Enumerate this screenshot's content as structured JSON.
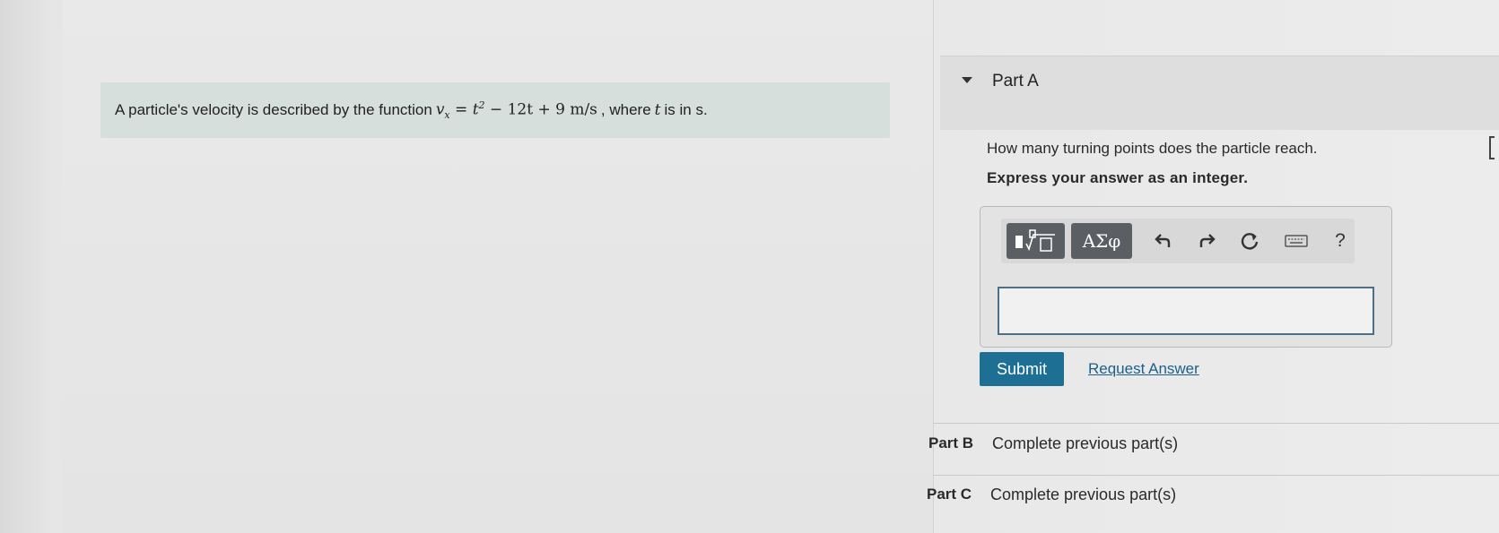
{
  "problem": {
    "prefix": "A particle's velocity is described by the function",
    "math_lhs": "v",
    "math_sub": "x",
    "math_eq": " = t",
    "math_sup": "2",
    "math_rest": " − 12t + 9 ",
    "math_unit": "m/s",
    "suffix": ", where",
    "var_t": "t",
    "suffix2": "is in s."
  },
  "part_a": {
    "title": "Part A",
    "question": "How many turning points does the particle reach.",
    "instruction": "Express your answer as an integer.",
    "answer_value": "",
    "toolbar": {
      "templates_icon": "templates-radical-icon",
      "greek_label": "ΑΣφ",
      "undo_icon": "undo-icon",
      "redo_icon": "redo-icon",
      "reset_icon": "reset-icon",
      "keyboard_icon": "keyboard-icon",
      "help_label": "?"
    },
    "submit_label": "Submit",
    "request_answer_label": "Request Answer"
  },
  "parts": [
    {
      "label": "Part B",
      "status": "Complete previous part(s)"
    },
    {
      "label": "Part C",
      "status": "Complete previous part(s)"
    }
  ]
}
